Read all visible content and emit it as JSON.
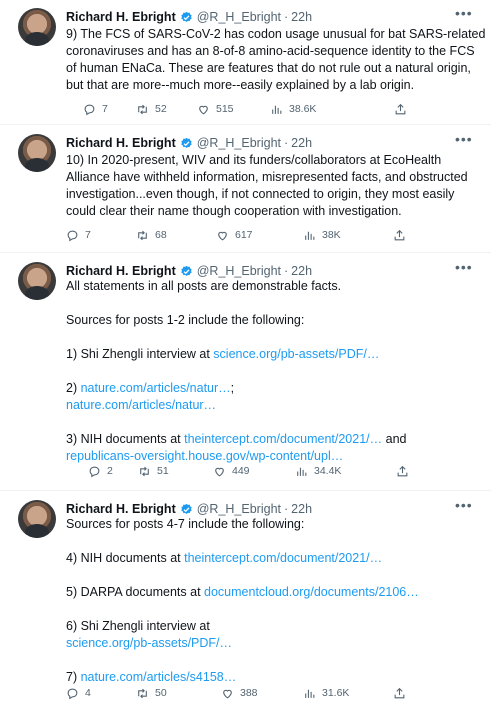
{
  "author": {
    "name": "Richard H. Ebright",
    "handle": "@R_H_Ebright",
    "separator": "·",
    "time": "22h"
  },
  "tweets": [
    {
      "lines": [
        "9) The FCS of SARS-CoV-2 has codon usage unusual for bat SARS-related",
        "coronaviruses and has an 8-of-8 amino-acid-sequence identity to the FCS",
        "of human ENaCa. These are features that do not rule out a natural origin,",
        "but that are more--much more--easily explained by a lab origin."
      ],
      "replies": "7",
      "retweets": "52",
      "likes": "515",
      "views": "38.6K"
    },
    {
      "lines": [
        "10) In 2020-present, WIV and its funders/collaborators at EcoHealth",
        "Alliance have withheld information, misrepresented facts, and obstructed",
        "investigation...even though, if not connected to origin, they most easily",
        "could clear their name though cooperation with investigation."
      ],
      "replies": "7",
      "retweets": "68",
      "likes": "617",
      "views": "38K"
    },
    {
      "l1": "All statements in all posts are demonstrable facts.",
      "l2": "Sources for posts 1-2 include the following:",
      "l3a": "1) Shi Zhengli interview at ",
      "l3b": "science.org/pb-assets/PDF/…",
      "l4a": "2) ",
      "l4b": "nature.com/articles/natur…",
      "l4c": ";",
      "l5": "nature.com/articles/natur…",
      "l6a": "3) NIH documents at ",
      "l6b": "theintercept.com/document/2021/…",
      "l6c": " and",
      "l7": "republicans-oversight.house.gov/wp-content/upl…",
      "replies": "2",
      "retweets": "51",
      "likes": "449",
      "views": "34.4K"
    },
    {
      "l1": "Sources for posts 4-7 include the following:",
      "l2a": "4) NIH documents at ",
      "l2b": "theintercept.com/document/2021/…",
      "l3a": "5) DARPA documents at ",
      "l3b": "documentcloud.org/documents/2106…",
      "l4": "6) Shi Zhengli interview at",
      "l5": "science.org/pb-assets/PDF/…",
      "l6a": "7) ",
      "l6b": "nature.com/articles/s4158…",
      "replies": "4",
      "retweets": "50",
      "likes": "388",
      "views": "31.6K"
    }
  ],
  "colors": {
    "link": "#1d9bf0",
    "muted": "#536471",
    "verified": "#1d9bf0"
  },
  "icons": [
    "reply-icon",
    "retweet-icon",
    "like-icon",
    "views-icon",
    "share-icon",
    "verified-badge-icon",
    "more-icon"
  ]
}
